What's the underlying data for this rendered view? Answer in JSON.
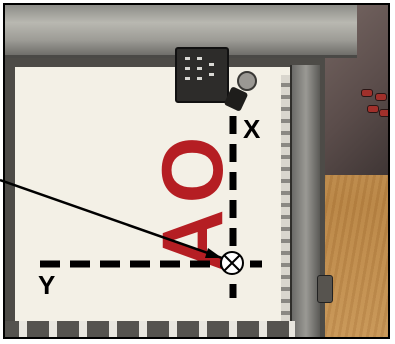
{
  "photo": {
    "printed_letters": "AO",
    "letters_color": "#b51e23"
  },
  "annotations": {
    "x_axis_label": "X",
    "y_axis_label": "Y",
    "origin_marker_icon": "circled-x-icon",
    "pointer_line_color": "#000000"
  }
}
